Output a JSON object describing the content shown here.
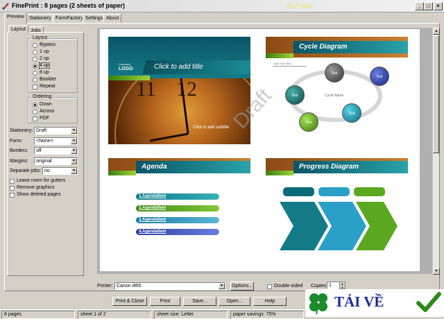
{
  "window": {
    "title": "FinePrint : 8 pages (2 sheets of paper)",
    "watermark": "ŚAZ Hilfe"
  },
  "tabs": [
    "Preview",
    "Stationery",
    "FormFactory",
    "Settings",
    "About"
  ],
  "subtabs": [
    "Layout",
    "Jobs"
  ],
  "layout_group": {
    "label": "Layout",
    "options": [
      "Bypass",
      "1 up",
      "2 up",
      "4 up",
      "8 up",
      "Booklet",
      "Repeat"
    ],
    "selected": "4 up"
  },
  "ordering_group": {
    "label": "Ordering",
    "options": [
      "Down",
      "Across",
      "PDF"
    ],
    "selected": "Down"
  },
  "fields": [
    {
      "label": "Stationery:",
      "value": "Draft"
    },
    {
      "label": "Form:",
      "value": "<None>"
    },
    {
      "label": "Borders:",
      "value": "off"
    },
    {
      "label": "Margins:",
      "value": "original"
    },
    {
      "label": "Separate jobs:",
      "value": "no"
    }
  ],
  "checkboxes": [
    "Leave room for gutters",
    "Remove graphics",
    "Show deleted pages"
  ],
  "slides": {
    "s1": {
      "company": "Company",
      "logo": "LOGO",
      "title": "Click to add title",
      "subtitle": "Click to add subtitle"
    },
    "s2": {
      "title": "Cycle Diagram",
      "add_text": "Add Your Text",
      "center": "Cycle Name",
      "node": "Text"
    },
    "s3": {
      "title": "Agenda",
      "items": [
        "1.AgendaItem",
        "2.AgendaItem",
        "3.AgendaItem",
        "4.AgendaItem"
      ]
    },
    "s4": {
      "title": "Progress Diagram"
    }
  },
  "watermark_text": "Draft",
  "printer": {
    "label": "Printer:",
    "value": "Canon i865",
    "options_button": "Options...",
    "double_sided": "Double-sided",
    "copies_label": "Copies:",
    "copies": "1"
  },
  "buttons": [
    "Print & Close",
    "Print",
    "Save...",
    "Open...",
    "Help"
  ],
  "status": [
    "8 pages",
    "sheet 1 of 2",
    "sheet size: Letter",
    "paper savings: 75%"
  ],
  "logo": {
    "text": "TẢI VỀ"
  },
  "colors": {
    "teal": "#1a7f8c",
    "green": "#5aa820",
    "accent_blue": "#2a3fa0"
  }
}
